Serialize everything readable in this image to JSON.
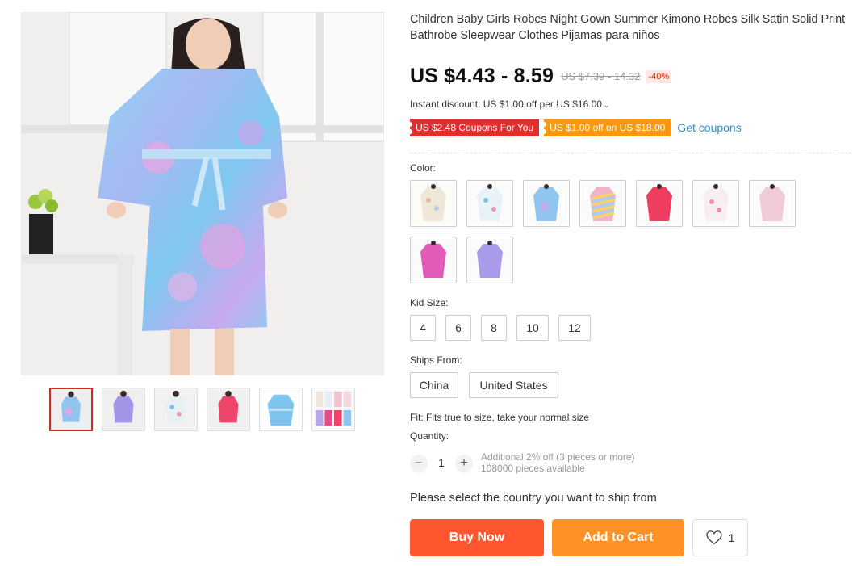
{
  "product": {
    "title": "Children Baby Girls Robes Night Gown Summer Kimono Robes Silk Satin Solid Print Bathrobe Sleepwear Clothes Pijamas para niños",
    "price": "US $4.43 - 8.59",
    "original_price": "US $7.39 - 14.32",
    "discount": "-40%",
    "instant_discount": "Instant discount: US $1.00 off per US $16.00",
    "chevron_icon": "chevron-down-icon"
  },
  "coupons": [
    {
      "label": "US $2.48 Coupons For You",
      "color": "#e02d2d"
    },
    {
      "label": "US $1.00 off on US $18.00",
      "color": "#f8980f"
    }
  ],
  "get_coupons": "Get coupons",
  "color": {
    "label": "Color:",
    "swatches": [
      "cream-floral",
      "white-floral",
      "blue-tie-dye",
      "rainbow-stripe",
      "red-floral",
      "white-pink-floral",
      "light-pink",
      "magenta",
      "lavender"
    ]
  },
  "kid_size": {
    "label": "Kid Size:",
    "options": [
      "4",
      "6",
      "8",
      "10",
      "12"
    ]
  },
  "ships_from": {
    "label": "Ships From:",
    "options": [
      "China",
      "United States"
    ]
  },
  "fit": "Fit: Fits true to size, take your normal size",
  "quantity": {
    "label": "Quantity:",
    "value": "1",
    "minus": "−",
    "plus": "+",
    "note_line1": "Additional 2% off (3 pieces or more)",
    "note_line2": "108000 pieces available"
  },
  "ship_message": "Please select the country you want to ship from",
  "actions": {
    "buy_now": "Buy Now",
    "add_to_cart": "Add to Cart",
    "wishlist_count": "1",
    "wishlist_icon": "heart-icon"
  },
  "colors": {
    "accent_red": "#e02d2d",
    "accent_orange": "#f8980f",
    "buy_now": "#ff5630",
    "add_to_cart": "#ff9227",
    "link": "#2e8fcf"
  }
}
